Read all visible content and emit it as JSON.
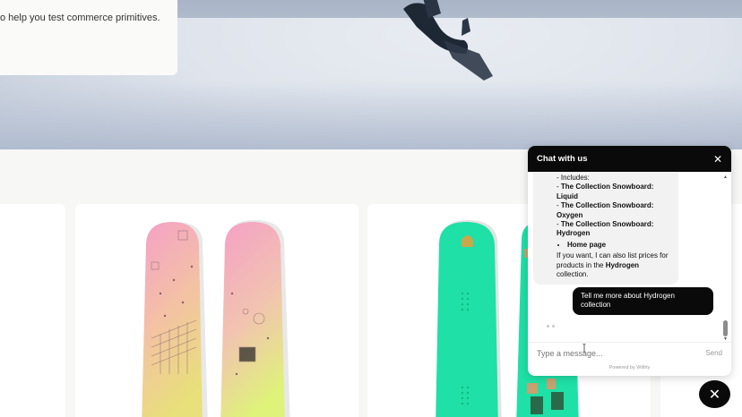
{
  "hero": {
    "subtitle": "o help you test commerce primitives."
  },
  "chat": {
    "title": "Chat with us",
    "bot_message": {
      "intro": "- Includes:",
      "items": [
        {
          "prefix": "- ",
          "name": "The Collection Snowboard: Liquid"
        },
        {
          "prefix": "- ",
          "name": "The Collection Snowboard: Oxygen"
        },
        {
          "prefix": "- ",
          "name": "The Collection Snowboard: Hydrogen"
        }
      ],
      "bullet": "Home page",
      "outro_before": "If you want, I can also list prices for products in the ",
      "outro_bold": "Hydrogen",
      "outro_after": " collection."
    },
    "user_message": "Tell me more about Hydrogen collection",
    "input_placeholder": "Type a message...",
    "send_label": "Send",
    "powered_by": "Powered by Withly"
  },
  "colors": {
    "chat_header": "#0a0a0a",
    "board_pink": "#f0a0c0",
    "board_lime": "#dff07a",
    "board_teal": "#1fe0a6"
  }
}
